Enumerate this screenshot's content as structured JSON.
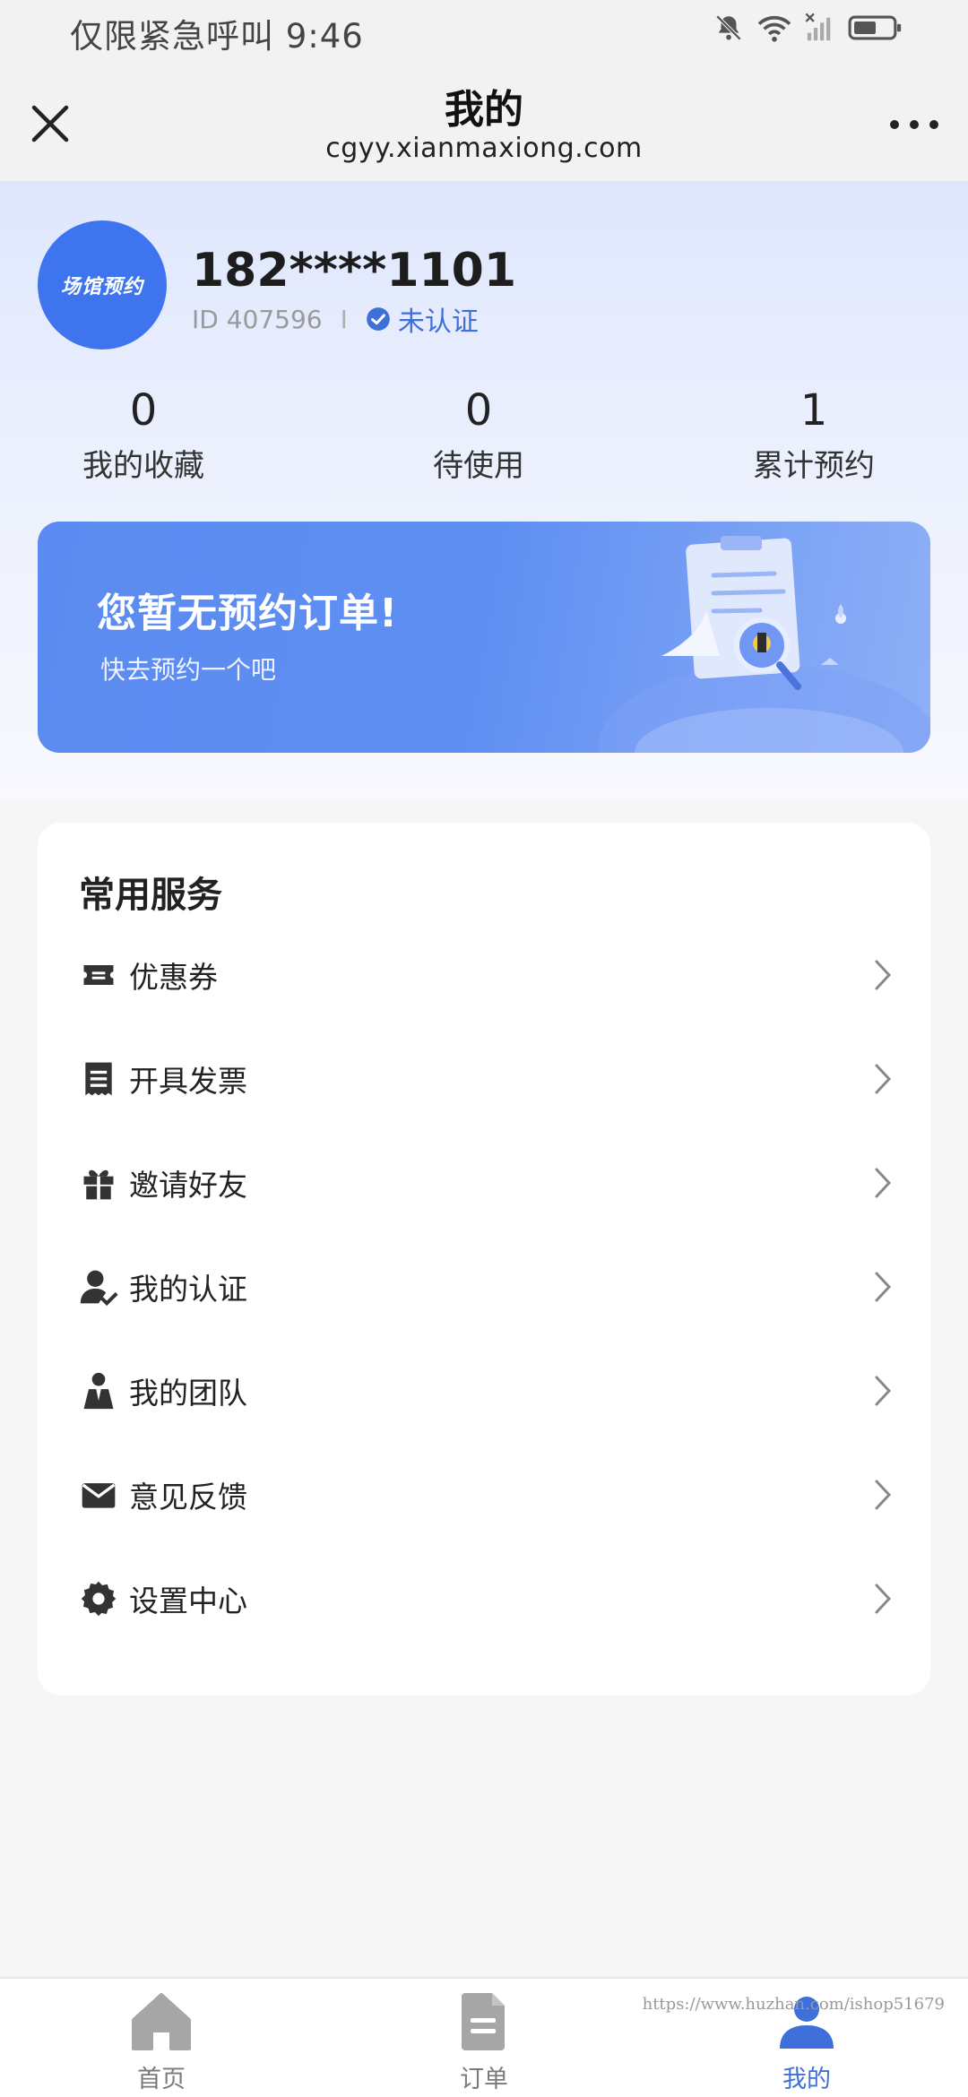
{
  "status_bar": {
    "text": "仅限紧急呼叫 9:46",
    "icons": [
      "bell-off-icon",
      "wifi-icon",
      "signal-icon",
      "battery-icon"
    ]
  },
  "header": {
    "title": "我的",
    "url": "cgyy.xianmaxiong.com",
    "close_icon": "close-icon",
    "more_icon": "more-icon"
  },
  "profile": {
    "avatar_text": "场馆预约",
    "phone": "182****1101",
    "id_text": "ID 407596",
    "separator": "I",
    "verify_status": "未认证"
  },
  "stats": [
    {
      "value": "0",
      "label": "我的收藏"
    },
    {
      "value": "0",
      "label": "待使用"
    },
    {
      "value": "1",
      "label": "累计预约"
    }
  ],
  "banner": {
    "title": "您暂无预约订单!",
    "subtitle": "快去预约一个吧"
  },
  "services": {
    "title": "常用服务",
    "items": [
      {
        "label": "优惠券",
        "icon": "ticket-icon"
      },
      {
        "label": "开具发票",
        "icon": "invoice-icon"
      },
      {
        "label": "邀请好友",
        "icon": "gift-icon"
      },
      {
        "label": "我的认证",
        "icon": "user-check-icon"
      },
      {
        "label": "我的团队",
        "icon": "team-icon"
      },
      {
        "label": "意见反馈",
        "icon": "mail-icon"
      },
      {
        "label": "设置中心",
        "icon": "gear-icon"
      }
    ]
  },
  "bottom_nav": {
    "items": [
      {
        "label": "首页",
        "icon": "home-icon",
        "active": false
      },
      {
        "label": "订单",
        "icon": "document-icon",
        "active": false
      },
      {
        "label": "我的",
        "icon": "user-icon",
        "active": true
      }
    ],
    "watermark": "https://www.huzhan.com/ishop51679"
  },
  "colors": {
    "accent": "#3f6fd8",
    "avatar_bg": "#3f74ef",
    "banner_start": "#5b8bf0",
    "inactive_nav": "#a6a6a6"
  }
}
